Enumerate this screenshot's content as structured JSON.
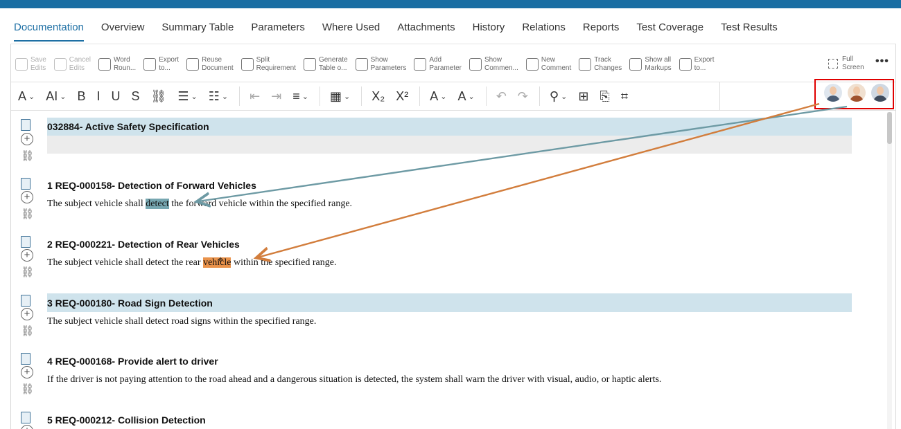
{
  "tabs": [
    {
      "label": "Documentation",
      "active": true
    },
    {
      "label": "Overview"
    },
    {
      "label": "Summary Table"
    },
    {
      "label": "Parameters"
    },
    {
      "label": "Where Used"
    },
    {
      "label": "Attachments"
    },
    {
      "label": "History"
    },
    {
      "label": "Relations"
    },
    {
      "label": "Reports"
    },
    {
      "label": "Test Coverage"
    },
    {
      "label": "Test Results"
    }
  ],
  "ribbon": [
    {
      "label": "Save\nEdits",
      "icon": "save-icon",
      "disabled": true
    },
    {
      "label": "Cancel\nEdits",
      "icon": "cancel-edit-icon",
      "disabled": true
    },
    {
      "label": "Word\nRoun...",
      "icon": "word-roundtrip-icon"
    },
    {
      "label": "Export\nto...",
      "icon": "export-icon"
    },
    {
      "label": "Reuse\nDocument",
      "icon": "reuse-document-icon"
    },
    {
      "label": "Split\nRequirement",
      "icon": "split-icon"
    },
    {
      "label": "Generate\nTable o...",
      "icon": "generate-table-icon"
    },
    {
      "label": "Show\nParameters",
      "icon": "show-parameters-icon"
    },
    {
      "label": "Add\nParameter",
      "icon": "add-parameter-icon"
    },
    {
      "label": "Show\nCommen...",
      "icon": "show-comments-icon"
    },
    {
      "label": "New\nComment",
      "icon": "new-comment-icon"
    },
    {
      "label": "Track\nChanges",
      "icon": "track-changes-icon"
    },
    {
      "label": "Show all\nMarkups",
      "icon": "show-markups-icon"
    },
    {
      "label": "Export\nto...",
      "icon": "export-to-icon"
    }
  ],
  "fullscreen_label": "Full\nScreen",
  "more_label": "•••",
  "format_toolbar": [
    {
      "glyph": "A",
      "name": "font-size-icon",
      "caret": true
    },
    {
      "glyph": "AI",
      "name": "font-style-icon",
      "caret": true
    },
    {
      "glyph": "B",
      "name": "bold-icon"
    },
    {
      "glyph": "I",
      "name": "italic-icon"
    },
    {
      "glyph": "U",
      "name": "underline-icon"
    },
    {
      "glyph": "S",
      "name": "strikethrough-icon"
    },
    {
      "glyph": "⛓",
      "name": "link-icon"
    },
    {
      "glyph": "☰",
      "name": "bullet-list-icon",
      "caret": true
    },
    {
      "glyph": "☷",
      "name": "numbered-list-icon",
      "caret": true
    },
    {
      "sep": true
    },
    {
      "glyph": "⇤",
      "name": "outdent-icon",
      "dim": true
    },
    {
      "glyph": "⇥",
      "name": "indent-icon",
      "dim": true
    },
    {
      "glyph": "≡",
      "name": "align-icon",
      "caret": true
    },
    {
      "sep": true
    },
    {
      "glyph": "▦",
      "name": "table-icon",
      "caret": true
    },
    {
      "sep": true
    },
    {
      "glyph": "X₂",
      "name": "subscript-icon"
    },
    {
      "glyph": "X²",
      "name": "superscript-icon"
    },
    {
      "sep": true
    },
    {
      "glyph": "A",
      "name": "highlight-color-icon",
      "caret": true
    },
    {
      "glyph": "A",
      "name": "font-color-icon",
      "caret": true
    },
    {
      "sep": true
    },
    {
      "glyph": "↶",
      "name": "undo-icon",
      "dim": true
    },
    {
      "glyph": "↷",
      "name": "redo-icon",
      "dim": true
    },
    {
      "sep": true
    },
    {
      "glyph": "⚲",
      "name": "find-replace-icon",
      "caret": true
    },
    {
      "glyph": "⊞",
      "name": "insert-image-icon"
    },
    {
      "glyph": "⎘",
      "name": "insert-file-icon"
    },
    {
      "glyph": "⌗",
      "name": "insert-table-plus-icon"
    }
  ],
  "avatars": [
    {
      "name": "avatar-user-1",
      "underline": "#e9924b",
      "body": "#4a5d74",
      "bg": "#dfe6ee"
    },
    {
      "name": "avatar-user-2",
      "underline": "#77a7b1",
      "body": "#a0522d",
      "bg": "#f0e0d0"
    },
    {
      "name": "avatar-user-3",
      "underline": "#1d6fa4",
      "body": "#3e4b5c",
      "bg": "#cfd8e2"
    }
  ],
  "document": {
    "title": "032884- Active Safety Specification",
    "requirements": [
      {
        "heading": "1 REQ-000158- Detection of Forward Vehicles",
        "before": "The subject vehicle shall ",
        "highlight": "detect",
        "hl": "teal",
        "after": " the forward vehicle within the specified range."
      },
      {
        "heading": "2 REQ-000221- Detection of Rear Vehicles",
        "before": "The subject vehicle shall detect the rear ",
        "highlight": "vehicle",
        "hl": "orange",
        "after": " within the specified range."
      },
      {
        "heading": "3 REQ-000180- Road Sign Detection",
        "before": "The subject vehicle shall detect road signs within the specified range.",
        "highlight": "",
        "hl": "",
        "after": "",
        "banded": true
      },
      {
        "heading": "4 REQ-000168- Provide alert to driver",
        "before": "If the driver is not paying attention to the road ahead and a dangerous situation is detected, the system shall warn the driver with visual, audio, or haptic alerts.",
        "highlight": "",
        "hl": "",
        "after": ""
      },
      {
        "heading": "5 REQ-000212- Collision Detection",
        "before": "",
        "highlight": "",
        "hl": "",
        "after": ""
      }
    ]
  },
  "colors": {
    "accent": "#1d6fa4",
    "teal_arrow": "#6d9aa4",
    "orange_arrow": "#d27d3c",
    "callout_border": "#e00000"
  }
}
